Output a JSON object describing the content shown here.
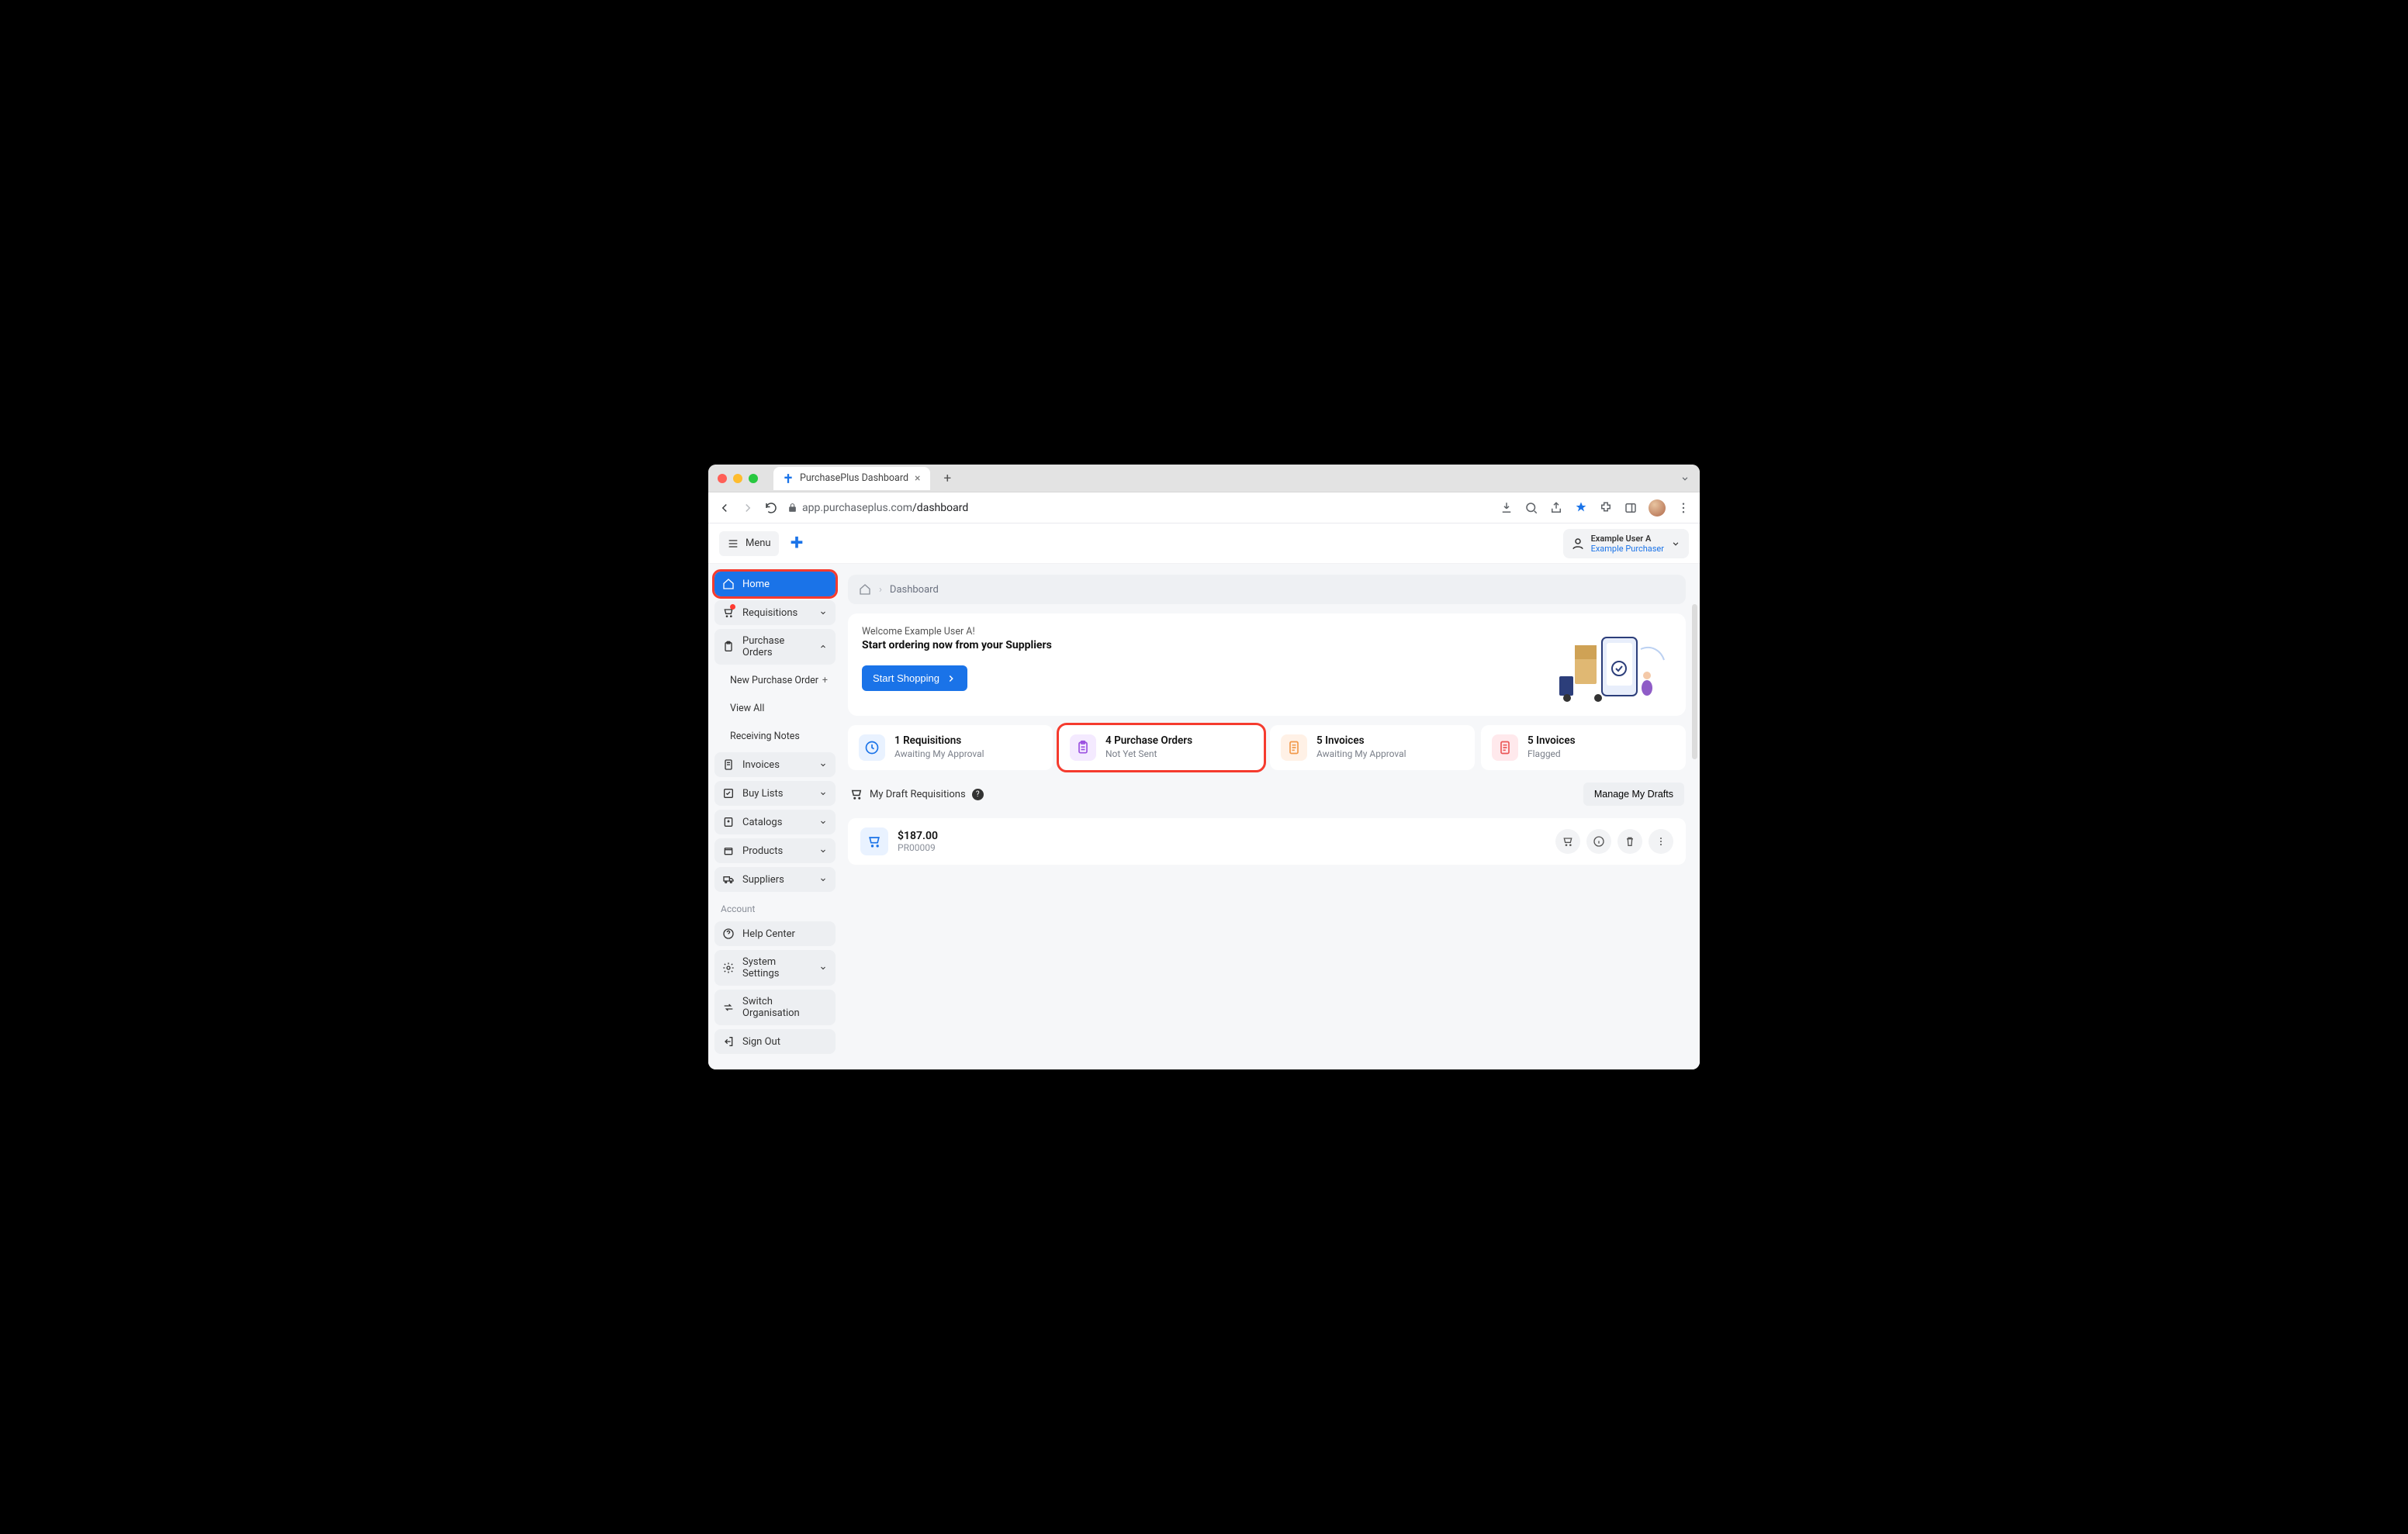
{
  "browser_tab_title": "PurchasePlus Dashboard",
  "url_host": "app.purchaseplus.com",
  "url_path": "/dashboard",
  "header": {
    "menu_label": "Menu",
    "user_name": "Example User A",
    "user_org": "Example Purchaser"
  },
  "sidebar": {
    "items": [
      {
        "label": "Home"
      },
      {
        "label": "Requisitions"
      },
      {
        "label": "Purchase Orders"
      },
      {
        "label": "Invoices"
      },
      {
        "label": "Buy Lists"
      },
      {
        "label": "Catalogs"
      },
      {
        "label": "Products"
      },
      {
        "label": "Suppliers"
      }
    ],
    "po_sub": [
      {
        "label": "New Purchase Order"
      },
      {
        "label": "View All"
      },
      {
        "label": "Receiving Notes"
      }
    ],
    "account_label": "Account",
    "account_items": [
      {
        "label": "Help Center"
      },
      {
        "label": "System Settings"
      },
      {
        "label": "Switch Organisation"
      },
      {
        "label": "Sign Out"
      }
    ]
  },
  "breadcrumb": {
    "current": "Dashboard"
  },
  "hero": {
    "welcome": "Welcome Example User A!",
    "subtitle": "Start ordering now from your Suppliers",
    "cta": "Start Shopping"
  },
  "cards": [
    {
      "title": "1 Requisitions",
      "sub": "Awaiting My Approval"
    },
    {
      "title": "4 Purchase Orders",
      "sub": "Not Yet Sent"
    },
    {
      "title": "5 Invoices",
      "sub": "Awaiting My Approval"
    },
    {
      "title": "5 Invoices",
      "sub": "Flagged"
    }
  ],
  "drafts": {
    "header": "My Draft Requisitions",
    "manage": "Manage My Drafts",
    "rows": [
      {
        "amount": "$187.00",
        "ref": "PR00009"
      }
    ]
  }
}
